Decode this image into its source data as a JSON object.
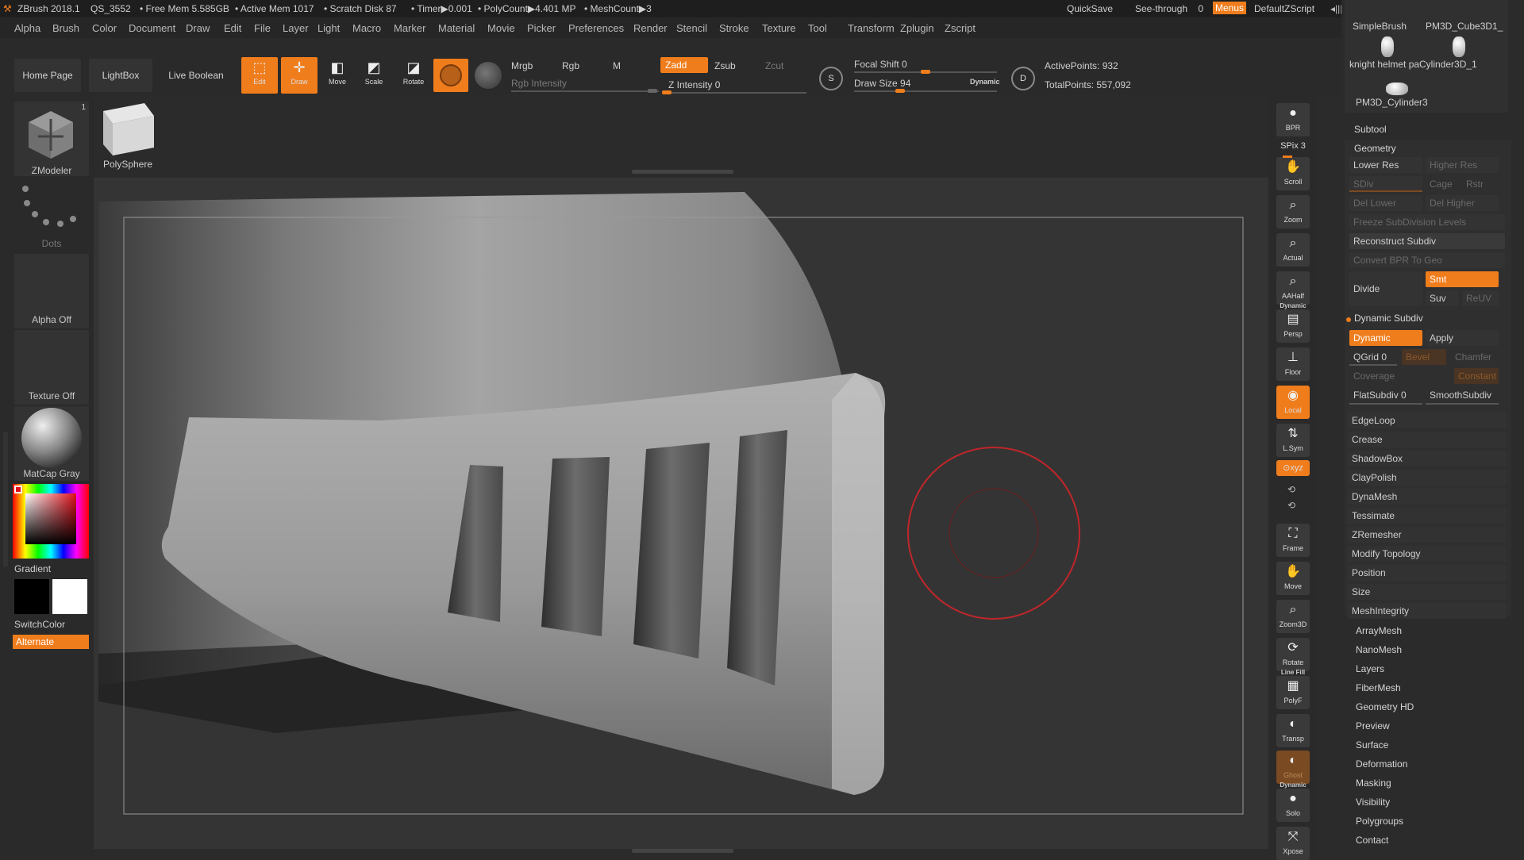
{
  "titlebar": {
    "app": "ZBrush 2018.1",
    "file": "QS_3552",
    "free_mem": "• Free Mem 5.585GB",
    "active_mem": "• Active Mem 1017",
    "scratch": "• Scratch Disk 87",
    "timer": "• Timer▶0.001",
    "polycount": "• PolyCount▶4.401 MP",
    "meshcount": "• MeshCount▶3",
    "quicksave": "QuickSave",
    "see_through": "See-through",
    "see_through_value": "0",
    "menus": "Menus",
    "default_script": "DefaultZScript"
  },
  "menubar": [
    "Alpha",
    "Brush",
    "Color",
    "Document",
    "Draw",
    "Edit",
    "File",
    "Layer",
    "Light",
    "Macro",
    "Marker",
    "Material",
    "Movie",
    "Picker",
    "Preferences",
    "Render",
    "Stencil",
    "Stroke",
    "Texture",
    "Tool",
    "Transform",
    "Zplugin",
    "Zscript"
  ],
  "toolbar": {
    "home_page": "Home Page",
    "lightbox": "LightBox",
    "live_boolean": "Live Boolean",
    "edit": "Edit",
    "draw": "Draw",
    "move": "Move",
    "scale": "Scale",
    "rotate": "Rotate",
    "mrgb": "Mrgb",
    "rgb": "Rgb",
    "m": "M",
    "zadd": "Zadd",
    "zsub": "Zsub",
    "zcut": "Zcut",
    "rgb_intensity": "Rgb Intensity",
    "z_intensity": "Z Intensity 0",
    "focal_shift": "Focal Shift 0",
    "draw_size": "Draw Size 94",
    "dynamic": "Dynamic",
    "active_points": "ActivePoints: 932",
    "total_points": "TotalPoints: 557,092"
  },
  "leftpanel": {
    "zmodeler": "ZModeler",
    "zmodeler_count": "1",
    "polysphere": "PolySphere",
    "dots": "Dots",
    "alpha_off": "Alpha Off",
    "texture_off": "Texture Off",
    "matcap": "MatCap Gray",
    "gradient": "Gradient",
    "switchcolor": "SwitchColor",
    "alternate": "Alternate"
  },
  "rightshelf": {
    "bpr": "BPR",
    "spix": "SPix 3",
    "scroll": "Scroll",
    "zoom": "Zoom",
    "actual": "Actual",
    "aahalf": "AAHalf",
    "dynamic_persp": "Dynamic",
    "persp": "Persp",
    "floor": "Floor",
    "local": "Local",
    "lsym": "L.Sym",
    "xyz": "⊙xyz",
    "frame": "Frame",
    "move": "Move",
    "zoom3d": "Zoom3D",
    "rotate": "Rotate",
    "linefill": "Line Fill",
    "polyf": "PolyF",
    "transp": "Transp",
    "ghost": "Ghost",
    "dynamic_solo": "Dynamic",
    "solo": "Solo",
    "xpose": "Xpose"
  },
  "rightpanel": {
    "tools": [
      "SimpleBrush",
      "PM3D_Cube3D1_",
      "knight helmet pa",
      "Cylinder3D_1",
      "PM3D_Cylinder3"
    ],
    "subtool": "Subtool",
    "geometry": "Geometry",
    "lower_res": "Lower Res",
    "higher_res": "Higher Res",
    "sdiv": "SDiv",
    "cage": "Cage",
    "rstr": "Rstr",
    "del_lower": "Del Lower",
    "del_higher": "Del Higher",
    "freeze": "Freeze SubDivision Levels",
    "reconstruct": "Reconstruct Subdiv",
    "convert_bpr": "Convert BPR To Geo",
    "divide": "Divide",
    "smt": "Smt",
    "suv": "Suv",
    "reuv": "ReUV",
    "dynamic_subdiv": "Dynamic Subdiv",
    "dynamic": "Dynamic",
    "apply": "Apply",
    "qgrid": "QGrid 0",
    "bevel": "Bevel",
    "chamfer": "Chamfer",
    "coverage": "Coverage",
    "constant": "Constant",
    "flatsubdiv": "FlatSubdiv 0",
    "smoothsubdiv": "SmoothSubdiv",
    "geo_items": [
      "EdgeLoop",
      "Crease",
      "ShadowBox",
      "ClayPolish",
      "DynaMesh",
      "Tessimate",
      "ZRemesher",
      "Modify Topology",
      "Position",
      "Size",
      "MeshIntegrity"
    ],
    "sections": [
      "ArrayMesh",
      "NanoMesh",
      "Layers",
      "FiberMesh",
      "Geometry HD",
      "Preview",
      "Surface",
      "Deformation",
      "Masking",
      "Visibility",
      "Polygroups",
      "Contact"
    ]
  },
  "colors": {
    "accent": "#f07d1c",
    "brush_ring": "#c0262a"
  }
}
